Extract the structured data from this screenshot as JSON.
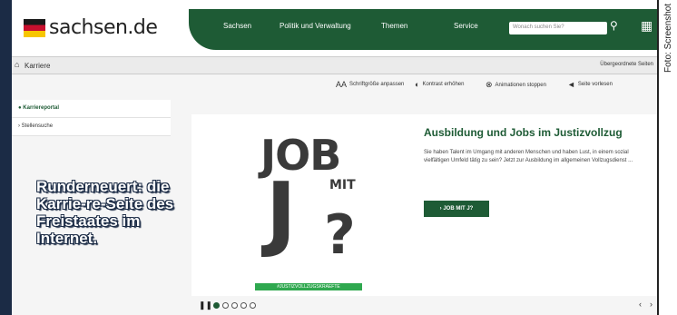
{
  "logo": {
    "text": "sachsen.de"
  },
  "nav": {
    "items": [
      {
        "label": "Sachsen"
      },
      {
        "label": "Politik und Verwaltung"
      },
      {
        "label": "Themen"
      },
      {
        "label": "Service"
      }
    ],
    "search_placeholder": "Wonach suchen Sie?"
  },
  "breadcrumb": {
    "current": "Karriere",
    "right_link": "Übergeordnete Seiten"
  },
  "a11y": {
    "font_size": "Schriftgröße anpassen",
    "contrast": "Kontrast erhöhen",
    "animations": "Animationen stoppen",
    "read_aloud": "Seite vorlesen"
  },
  "sidebar": {
    "items": [
      {
        "label": "Karriereportal"
      },
      {
        "label": "Stellensuche"
      }
    ]
  },
  "teaser": {
    "graphic_job": "JOB",
    "graphic_mit": "MIT",
    "graphic_j": "J",
    "graphic_q": "?",
    "graphic_strip": "#JUSTIZVOLLZUGSKRAEFTE",
    "title": "Ausbildung und Jobs im Justizvollzug",
    "text": "Sie haben Talent im Umgang mit anderen Menschen und haben Lust, in einem sozial vielfältigen Umfeld tätig zu sein? Jetzt zur Ausbildung im allgemeinen Vollzugsdienst ...",
    "button": "› JOB MIT J?"
  },
  "slider": {
    "slides": 5,
    "active_index": 0
  },
  "caption": "Runderneuert: die Karrie-re-Seite des Freistaates im Internet.",
  "credit": "Foto: Screenshot",
  "colors": {
    "brand_green": "#1e5b35",
    "caption_navy": "#1b2b45"
  }
}
